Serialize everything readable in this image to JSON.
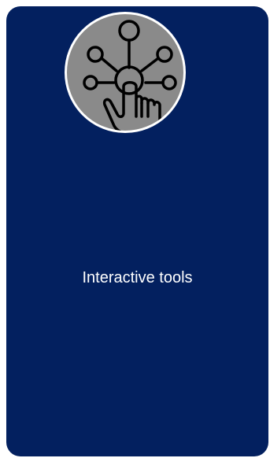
{
  "card": {
    "label": "Interactive tools",
    "icon": "hand-pointer-network-icon",
    "background_color": "#03205f",
    "icon_circle_color": "#8a8a8a",
    "icon_stroke_color": "#000000",
    "border_color": "#ffffff",
    "text_color": "#ffffff"
  }
}
